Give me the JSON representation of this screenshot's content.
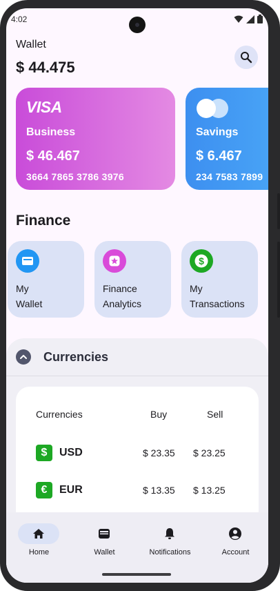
{
  "status_bar": {
    "time": "4:02"
  },
  "header": {
    "wallet_label": "Wallet",
    "balance": "$ 44.475"
  },
  "cards": [
    {
      "brand": "VISA",
      "name": "Business",
      "amount": "$ 46.467",
      "number": "3664 7865 3786 3976",
      "color_start": "#c94cd9",
      "color_end": "#e48ae3"
    },
    {
      "brand": "mastercard",
      "name": "Savings",
      "amount": "$ 6.467",
      "number": "234 7583 7899",
      "color_start": "#3d8ff0",
      "color_end": "#4aa7f7"
    }
  ],
  "finance": {
    "title": "Finance",
    "tiles": [
      {
        "line1": "My",
        "line2": "Wallet",
        "icon": "wallet-icon",
        "icon_color": "#2196f3"
      },
      {
        "line1": "Finance",
        "line2": "Analytics",
        "icon": "star-icon",
        "icon_color": "#d94bd9"
      },
      {
        "line1": "My",
        "line2": "Transactions",
        "icon": "dollar-icon",
        "icon_color": "#1da824"
      }
    ]
  },
  "currencies": {
    "title": "Currencies",
    "columns": {
      "name": "Currencies",
      "buy": "Buy",
      "sell": "Sell"
    },
    "rows": [
      {
        "symbol": "$",
        "code": "USD",
        "buy": "$ 23.35",
        "sell": "$ 23.25"
      },
      {
        "symbol": "€",
        "code": "EUR",
        "buy": "$ 13.35",
        "sell": "$ 13.25"
      }
    ]
  },
  "nav": {
    "items": [
      {
        "label": "Home",
        "icon": "home-icon",
        "active": true
      },
      {
        "label": "Wallet",
        "icon": "wallet-icon",
        "active": false
      },
      {
        "label": "Notifications",
        "icon": "bell-icon",
        "active": false
      },
      {
        "label": "Account",
        "icon": "account-icon",
        "active": false
      }
    ]
  }
}
